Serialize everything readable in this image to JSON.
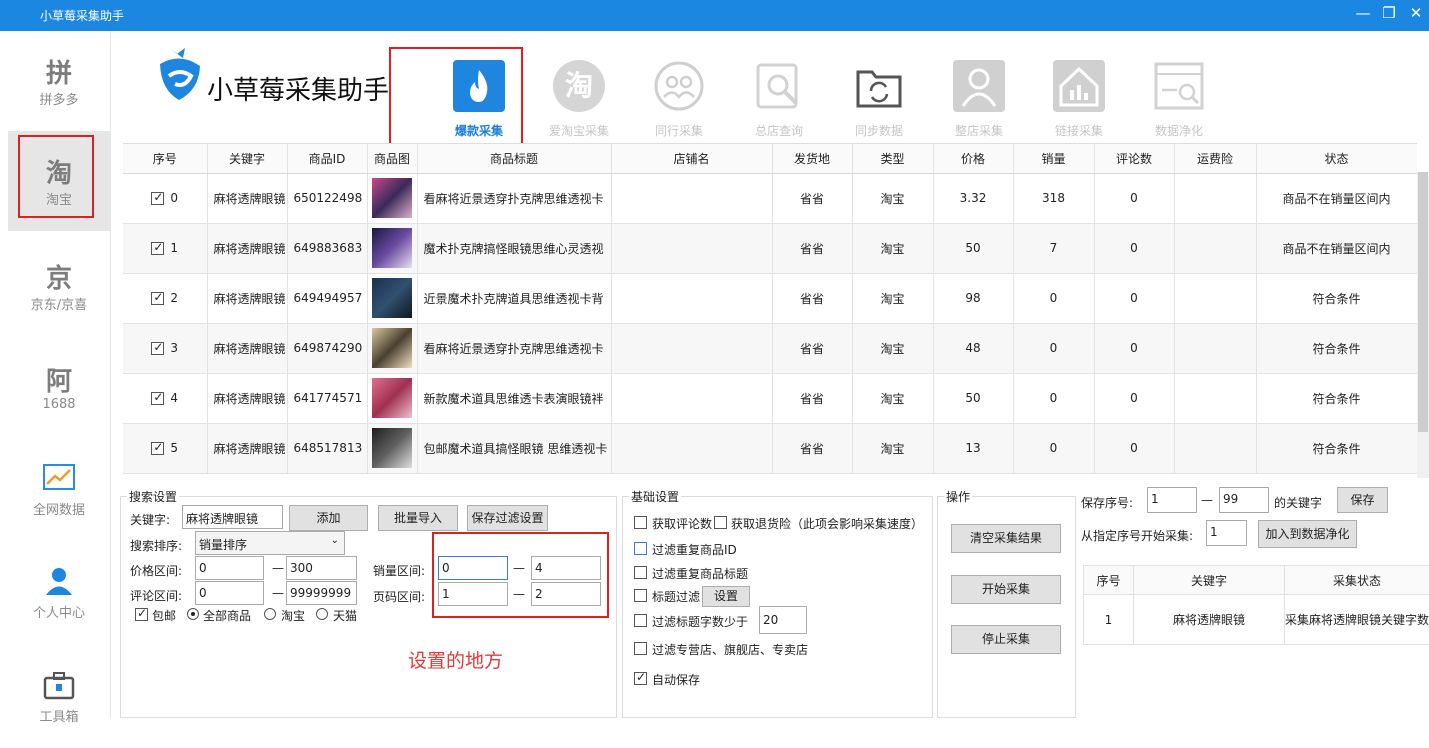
{
  "window": {
    "title": "小草莓采集助手"
  },
  "sidebar": [
    {
      "label": "拼多多",
      "icon": "拼"
    },
    {
      "label": "淘宝",
      "icon": "淘"
    },
    {
      "label": "京东/京喜",
      "icon": "京"
    },
    {
      "label": "1688",
      "icon": "阿"
    },
    {
      "label": "全网数据",
      "icon": "trend-chart-icon"
    },
    {
      "label": "个人中心",
      "icon": "user-icon"
    },
    {
      "label": "工具箱",
      "icon": "toolbox-icon"
    }
  ],
  "logo": {
    "text": "小草莓采集助手"
  },
  "toolbar": [
    {
      "label": "爆款采集",
      "icon": "flame-icon"
    },
    {
      "label": "爱淘宝采集",
      "icon": "淘"
    },
    {
      "label": "同行采集",
      "icon": "peers-icon"
    },
    {
      "label": "总店查询",
      "icon": "search-doc-icon"
    },
    {
      "label": "同步数据",
      "icon": "sync-folder-icon"
    },
    {
      "label": "整店采集",
      "icon": "person-icon"
    },
    {
      "label": "链接采集",
      "icon": "house-chart-icon"
    },
    {
      "label": "数据净化",
      "icon": "clean-data-icon"
    }
  ],
  "grid": {
    "columns": [
      "序号",
      "关键字",
      "商品ID",
      "商品图",
      "商品标题",
      "店铺名",
      "发货地",
      "类型",
      "价格",
      "销量",
      "评论数",
      "运费险",
      "状态"
    ],
    "rows": [
      {
        "idx": "0",
        "kw": "麻将透牌眼镜",
        "id": "650122498",
        "title": "看麻将近景透穿扑克牌思维透视卡",
        "shop": "",
        "ship": "省省",
        "type": "淘宝",
        "price": "3.32",
        "sales": "318",
        "comments": "0",
        "ins": "",
        "status": "商品不在销量区间内"
      },
      {
        "idx": "1",
        "kw": "麻将透牌眼镜",
        "id": "649883683",
        "title": "魔术扑克牌搞怪眼镜思维心灵透视",
        "shop": "",
        "ship": "省省",
        "type": "淘宝",
        "price": "50",
        "sales": "7",
        "comments": "0",
        "ins": "",
        "status": "商品不在销量区间内"
      },
      {
        "idx": "2",
        "kw": "麻将透牌眼镜",
        "id": "649494957",
        "title": "近景魔术扑克牌道具思维透视卡背",
        "shop": "",
        "ship": "省省",
        "type": "淘宝",
        "price": "98",
        "sales": "0",
        "comments": "0",
        "ins": "",
        "status": "符合条件"
      },
      {
        "idx": "3",
        "kw": "麻将透牌眼镜",
        "id": "649874290",
        "title": "看麻将近景透穿扑克牌思维透视卡",
        "shop": "",
        "ship": "省省",
        "type": "淘宝",
        "price": "48",
        "sales": "0",
        "comments": "0",
        "ins": "",
        "status": "符合条件"
      },
      {
        "idx": "4",
        "kw": "麻将透牌眼镜",
        "id": "641774571",
        "title": "新款魔术道具思维透卡表演眼镜袢",
        "shop": "",
        "ship": "省省",
        "type": "淘宝",
        "price": "50",
        "sales": "0",
        "comments": "0",
        "ins": "",
        "status": "符合条件"
      },
      {
        "idx": "5",
        "kw": "麻将透牌眼镜",
        "id": "648517813",
        "title": "包邮魔术道具搞怪眼镜 思维透视卡",
        "shop": "",
        "ship": "省省",
        "type": "淘宝",
        "price": "13",
        "sales": "0",
        "comments": "0",
        "ins": "",
        "status": "符合条件"
      }
    ]
  },
  "search": {
    "caption": "搜索设置",
    "keyword_label": "关键字:",
    "keyword_value": "麻将透牌眼镜",
    "add_btn": "添加",
    "import_btn": "批量导入",
    "save_filter_btn": "保存过滤设置",
    "sort_label": "搜索排序:",
    "sort_value": "销量排序",
    "price_label": "价格区间:",
    "price_min": "0",
    "price_max": "300",
    "comment_label": "评论区间:",
    "comment_min": "0",
    "comment_max": "99999999",
    "sales_label": "销量区间:",
    "sales_min": "0",
    "sales_max": "4",
    "page_label": "页码区间:",
    "page_min": "1",
    "page_max": "2",
    "dash": "—",
    "free_ship": "包邮",
    "all_goods": "全部商品",
    "taobao": "淘宝",
    "tmall": "天猫",
    "note": "设置的地方"
  },
  "basic": {
    "caption": "基础设置",
    "get_comments": "获取评论数",
    "get_return_ins": "获取退货险（此项会影响采集速度）",
    "filter_dup_id": "过滤重复商品ID",
    "filter_dup_title": "过滤重复商品标题",
    "title_filter": "标题过滤",
    "set_btn": "设置",
    "filter_title_len": "过滤标题字数少于",
    "title_len_value": "20",
    "filter_stores": "过滤专营店、旗舰店、专卖店",
    "auto_save": "自动保存"
  },
  "ops": {
    "caption": "操作",
    "clear_btn": "清空采集结果",
    "start_btn": "开始采集",
    "stop_btn": "停止采集"
  },
  "right": {
    "save_label": "保存序号:",
    "save_from": "1",
    "save_to": "99",
    "dash": "—",
    "save_suffix": "的关键字",
    "save_btn": "保存",
    "start_from_label": "从指定序号开始采集:",
    "start_from_value": "1",
    "add_clean_btn": "加入到数据净化",
    "table_headers": [
      "序号",
      "关键字",
      "采集状态"
    ],
    "table_rows": [
      {
        "idx": "1",
        "kw": "麻将透牌眼镜",
        "status": "采集麻将透牌眼镜关键字数据"
      }
    ]
  }
}
